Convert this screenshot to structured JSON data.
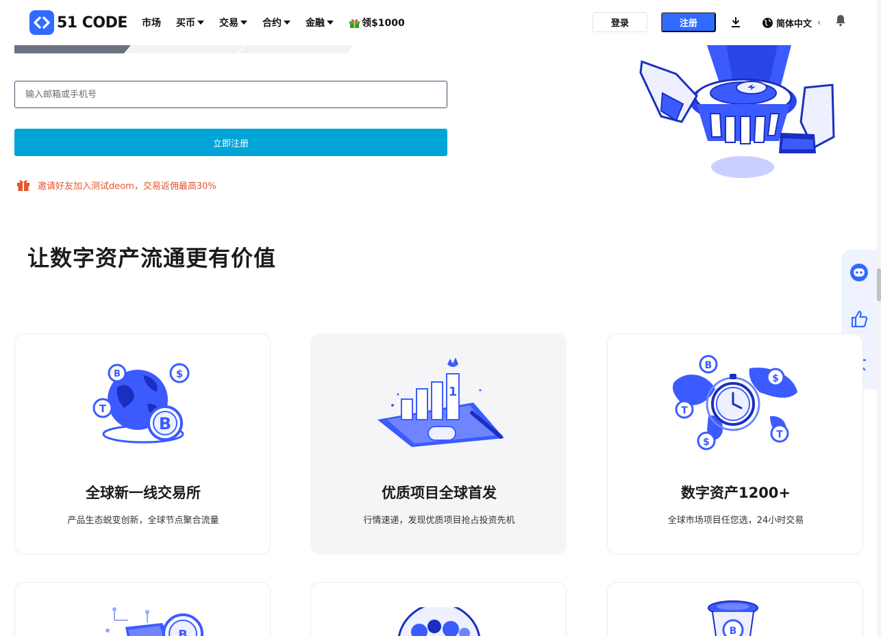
{
  "brand": {
    "logo_text": "51 CODE"
  },
  "nav": {
    "items": [
      {
        "label": "市场",
        "caret": false
      },
      {
        "label": "买币",
        "caret": true
      },
      {
        "label": "交易",
        "caret": true
      },
      {
        "label": "合约",
        "caret": true
      },
      {
        "label": "金融",
        "caret": true
      }
    ],
    "promo_label": "领$1000"
  },
  "header": {
    "login_label": "登录",
    "register_label": "注册",
    "language_label": "简体中文",
    "language_chevron": "‹"
  },
  "hero": {
    "input_placeholder": "输入邮箱或手机号",
    "submit_label": "立即注册",
    "invite_text": "邀请好友加入测试deom，交易返佣最高30%"
  },
  "section": {
    "headline": "让数字资产流通更有价值"
  },
  "features": [
    {
      "title": "全球新一线交易所",
      "desc": "产品生态蜕变创新，全球节点聚合流量"
    },
    {
      "title": "优质项目全球首发",
      "desc": "行情速递，发现优质项目抢占投资先机"
    },
    {
      "title": "数字资产1200+",
      "desc": "全球市场项目任您选，24小时交易"
    }
  ],
  "colors": {
    "primary": "#2f6bff",
    "submit": "#00a4d6",
    "invite": "#e8542c",
    "illustration": "#3b5bff"
  }
}
